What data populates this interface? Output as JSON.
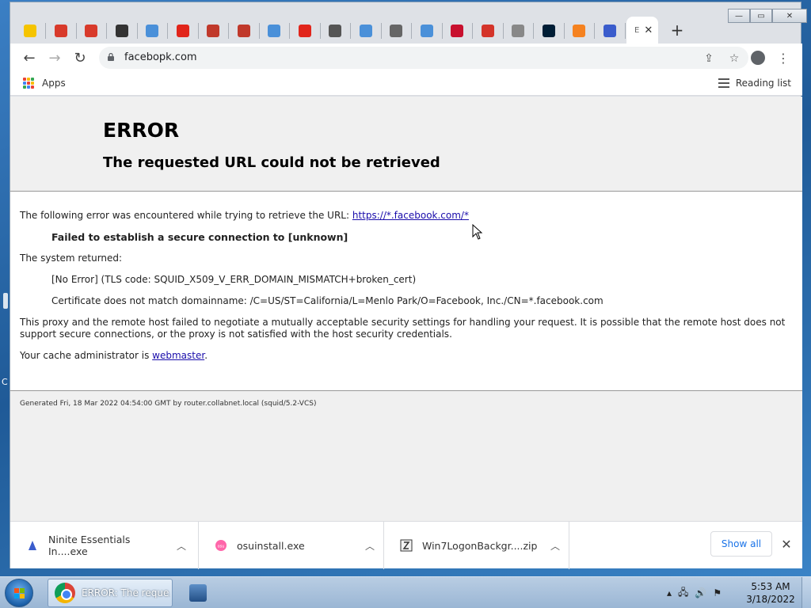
{
  "browser": {
    "active_tab_title": "E",
    "tabs": [
      {
        "icon": "norton-icon",
        "color": "#f5c400"
      },
      {
        "icon": "ccleaner-icon",
        "color": "#d83a2b"
      },
      {
        "icon": "ccleaner-icon",
        "color": "#d83a2b"
      },
      {
        "icon": "globe-icon",
        "color": "#333333"
      },
      {
        "icon": "web-icon",
        "color": "#4a90d9"
      },
      {
        "icon": "adobe-icon",
        "color": "#e1251b"
      },
      {
        "icon": "app-icon",
        "color": "#c0392b"
      },
      {
        "icon": "app-icon",
        "color": "#c0392b"
      },
      {
        "icon": "web-icon",
        "color": "#4a90d9"
      },
      {
        "icon": "adobe-icon",
        "color": "#e1251b"
      },
      {
        "icon": "chrome-icon",
        "color": "#555555"
      },
      {
        "icon": "web-icon",
        "color": "#4a90d9"
      },
      {
        "icon": "tool-icon",
        "color": "#666666"
      },
      {
        "icon": "web-icon",
        "color": "#4a90d9"
      },
      {
        "icon": "mcafee-icon",
        "color": "#c8102e"
      },
      {
        "icon": "acrobat-icon",
        "color": "#d4342a"
      },
      {
        "icon": "gear-icon",
        "color": "#888888"
      },
      {
        "icon": "photoshop-icon",
        "color": "#001e36"
      },
      {
        "icon": "avast-icon",
        "color": "#f58220"
      },
      {
        "icon": "ninite-icon",
        "color": "#3a5ccc"
      }
    ],
    "url": "facebopk.com",
    "bookmarks": {
      "apps_label": "Apps",
      "reading_list_label": "Reading list"
    }
  },
  "page": {
    "title": "ERROR",
    "subtitle": "The requested URL could not be retrieved",
    "intro_text": "The following error was encountered while trying to retrieve the URL: ",
    "intro_url": "https://*.facebook.com/*",
    "error_summary": "Failed to establish a secure connection to [unknown]",
    "system_returned_label": "The system returned:",
    "tls_code": "[No Error] (TLS code: SQUID_X509_V_ERR_DOMAIN_MISMATCH+broken_cert)",
    "cert_mismatch": "Certificate does not match domainname: /C=US/ST=California/L=Menlo Park/O=Facebook, Inc./CN=*.facebook.com",
    "explanation": "This proxy and the remote host failed to negotiate a mutually acceptable security settings for handling your request. It is possible that the remote host does not support secure connections, or the proxy is not satisfied with the host security credentials.",
    "admin_prefix": "Your cache administrator is ",
    "admin_link": "webmaster",
    "admin_suffix": ".",
    "generated": "Generated Fri, 18 Mar 2022 04:54:00 GMT by router.collabnet.local (squid/5.2-VCS)"
  },
  "downloads": {
    "items": [
      {
        "name": "Ninite Essentials In....exe",
        "icon": "ninite-icon"
      },
      {
        "name": "osuinstall.exe",
        "icon": "osu-icon"
      },
      {
        "name": "Win7LogonBackgr....zip",
        "icon": "zip-icon"
      }
    ],
    "show_all_label": "Show all"
  },
  "taskbar": {
    "chrome_label": "ERROR: The reque...",
    "time": "5:53 AM",
    "date": "3/18/2022"
  },
  "desktop": {
    "partial_label": "C"
  }
}
